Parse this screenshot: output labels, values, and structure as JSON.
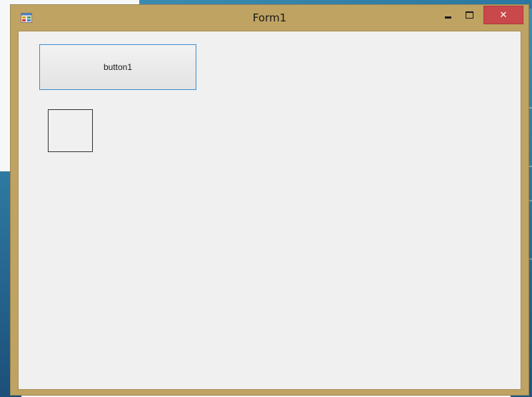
{
  "window": {
    "title": "Form1",
    "app_icon": "winforms-app-icon",
    "controls": {
      "minimize_icon": "minimize-icon",
      "maximize_icon": "maximize-icon",
      "close_glyph": "✕",
      "close_color": "#c9484a"
    },
    "frame_color": "#bfa362"
  },
  "form": {
    "button1_label": "button1",
    "button_border_color": "#3c8fd6",
    "client_background": "#f0f0f0"
  }
}
